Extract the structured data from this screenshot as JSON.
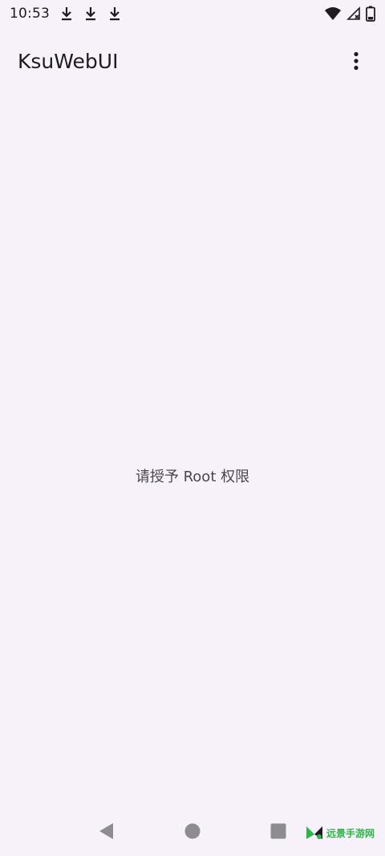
{
  "status_bar": {
    "time": "10:53",
    "left_icons": [
      "download-icon",
      "download-icon",
      "download-icon"
    ],
    "right_icons": [
      "wifi-icon",
      "cellular-no-signal-icon",
      "battery-icon"
    ]
  },
  "app_bar": {
    "title": "KsuWebUI",
    "menu_icon": "more-vert-icon"
  },
  "main": {
    "message": "请授予 Root 权限"
  },
  "nav_bar": {
    "buttons": [
      "back-icon",
      "home-icon",
      "recents-icon"
    ]
  },
  "watermark": {
    "text": "远景手游网"
  },
  "colors": {
    "background": "#f7f2f9",
    "text_primary": "#1d1b20",
    "text_secondary": "#49454f",
    "nav_icons": "#8e8c91",
    "watermark": "#2fb54a"
  }
}
